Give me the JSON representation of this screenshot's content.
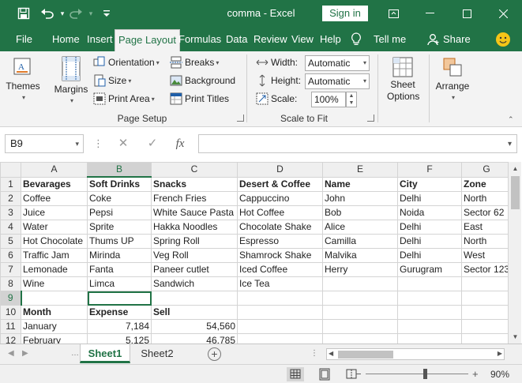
{
  "app": {
    "title": "comma  -  Excel",
    "sign_in": "Sign in"
  },
  "tabs": [
    {
      "label": "File"
    },
    {
      "label": "Home"
    },
    {
      "label": "Insert"
    },
    {
      "label": "Page Layout"
    },
    {
      "label": "Formulas"
    },
    {
      "label": "Data"
    },
    {
      "label": "Review"
    },
    {
      "label": "View"
    },
    {
      "label": "Help"
    }
  ],
  "tell_me": "Tell me",
  "share": "Share",
  "ribbon": {
    "themes": "Themes",
    "margins": "Margins",
    "orientation": "Orientation",
    "size": "Size",
    "print_area": "Print Area",
    "breaks": "Breaks",
    "background": "Background",
    "print_titles": "Print Titles",
    "page_setup_label": "Page Setup",
    "width_label": "Width:",
    "width_value": "Automatic",
    "height_label": "Height:",
    "height_value": "Automatic",
    "scale_label": "Scale:",
    "scale_value": "100%",
    "scale_to_fit_label": "Scale to Fit",
    "sheet_options": "Sheet Options",
    "arrange": "Arrange"
  },
  "formula_bar": {
    "name_box": "B9",
    "fx": "fx",
    "value": ""
  },
  "columns": [
    "A",
    "B",
    "C",
    "D",
    "E",
    "F",
    "G"
  ],
  "rows": [
    {
      "n": "1",
      "cells": [
        "Bevarages",
        "Soft Drinks",
        "Snacks",
        "Desert & Coffee",
        "Name",
        "City",
        "Zone"
      ]
    },
    {
      "n": "2",
      "cells": [
        "Coffee",
        "Coke",
        "French Fries",
        "Cappuccino",
        "John",
        "Delhi",
        "North"
      ]
    },
    {
      "n": "3",
      "cells": [
        "Juice",
        "Pepsi",
        "White Sauce Pasta",
        "Hot Coffee",
        "Bob",
        "Noida",
        "Sector 62"
      ]
    },
    {
      "n": "4",
      "cells": [
        "Water",
        "Sprite",
        "Hakka Noodles",
        "Chocolate Shake",
        "Alice",
        "Delhi",
        "East"
      ]
    },
    {
      "n": "5",
      "cells": [
        "Hot Chocolate",
        "Thums UP",
        "Spring Roll",
        "Espresso",
        "Camilla",
        "Delhi",
        "North"
      ]
    },
    {
      "n": "6",
      "cells": [
        "Traffic Jam",
        "Mirinda",
        "Veg Roll",
        "Shamrock Shake",
        "Malvika",
        "Delhi",
        "West"
      ]
    },
    {
      "n": "7",
      "cells": [
        "Lemonade",
        "Fanta",
        "Paneer cutlet",
        "Iced Coffee",
        "Herry",
        "Gurugram",
        "Sector 123"
      ]
    },
    {
      "n": "8",
      "cells": [
        "Wine",
        "Limca",
        "Sandwich",
        "Ice Tea",
        "",
        "",
        ""
      ]
    },
    {
      "n": "9",
      "cells": [
        "",
        "",
        "",
        "",
        "",
        "",
        ""
      ]
    },
    {
      "n": "10",
      "cells": [
        "Month",
        "Expense",
        "Sell",
        "",
        "",
        "",
        ""
      ]
    },
    {
      "n": "11",
      "cells": [
        "January",
        "7,184",
        "54,560",
        "",
        "",
        "",
        ""
      ]
    },
    {
      "n": "12",
      "cells": [
        "February",
        "5,125",
        "46,785",
        "",
        "",
        "",
        ""
      ]
    }
  ],
  "sheets": [
    {
      "label": "Sheet1",
      "active": true
    },
    {
      "label": "Sheet2",
      "active": false
    }
  ],
  "zoom": {
    "level": "90%",
    "minus": "−",
    "plus": "+"
  }
}
